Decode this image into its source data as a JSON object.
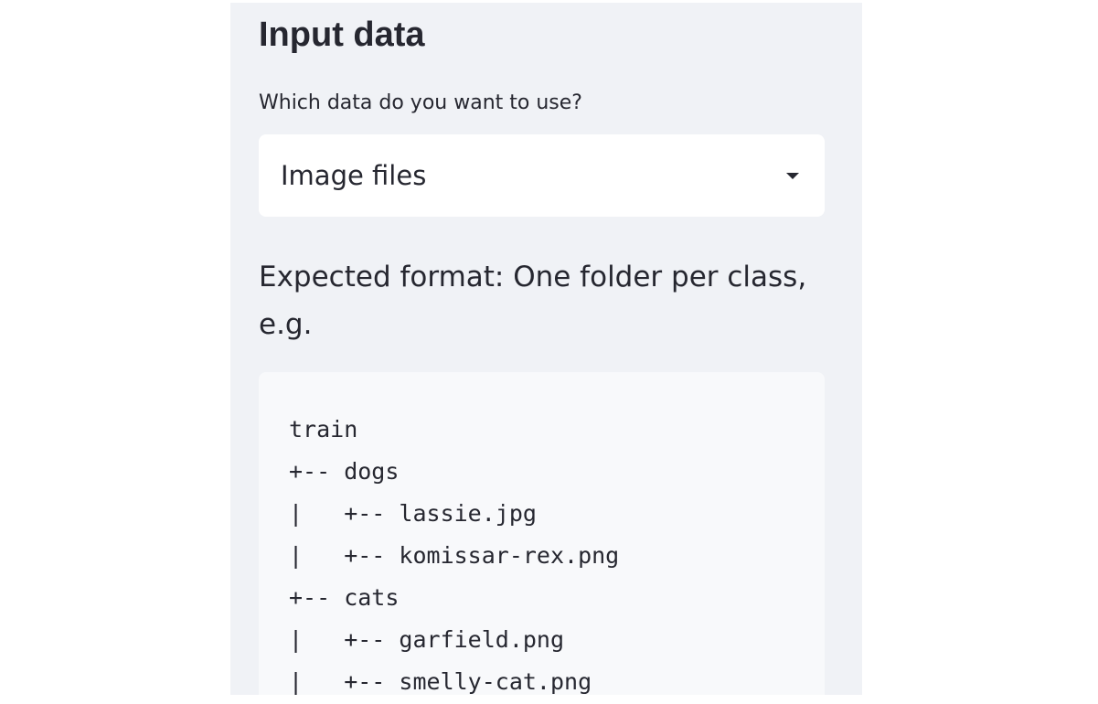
{
  "section": {
    "title": "Input data"
  },
  "data_select": {
    "question": "Which data do you want to use?",
    "selected": "Image files"
  },
  "format_info": {
    "text": "Expected format: One folder per class, e.g."
  },
  "code_example": {
    "lines": [
      "train",
      "+-- dogs",
      "|   +-- lassie.jpg",
      "|   +-- komissar-rex.png",
      "+-- cats",
      "|   +-- garfield.png",
      "|   +-- smelly-cat.png"
    ]
  },
  "icons": {
    "select_caret": "caret-down-icon"
  }
}
